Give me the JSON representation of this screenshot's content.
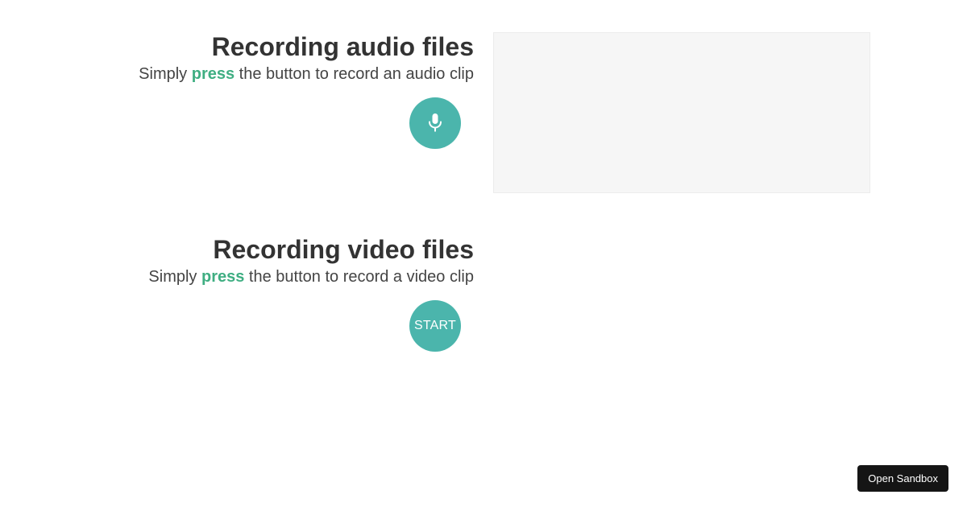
{
  "audio": {
    "title": "Recording audio files",
    "desc_before": "Simply ",
    "desc_accent": "press",
    "desc_after": " the button to record an audio clip",
    "button_icon": "microphone-icon"
  },
  "video": {
    "title": "Recording video files",
    "desc_before": "Simply ",
    "desc_accent": "press",
    "desc_after": " the button to record a video clip",
    "button_label": "START"
  },
  "sandbox": {
    "label": "Open Sandbox"
  },
  "colors": {
    "accent_text": "#3fae82",
    "button": "#4bb5ac",
    "panel": "#f6f6f6",
    "sandbox_bg": "#151515"
  }
}
